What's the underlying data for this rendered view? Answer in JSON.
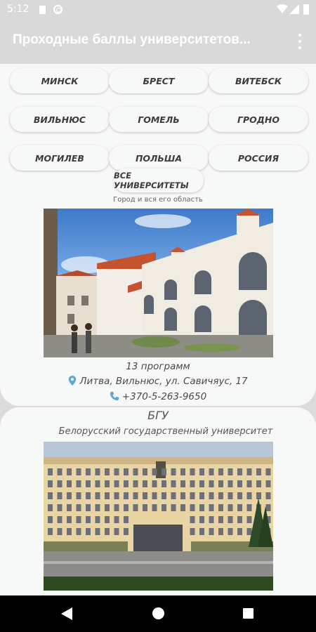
{
  "status_bar": {
    "time": "5:12"
  },
  "app_bar": {
    "title": "Проходные баллы университетов..."
  },
  "filters": {
    "cities": [
      "МИНСК",
      "БРЕСТ",
      "ВИТЕБСК",
      "ВИЛЬНЮС",
      "ГОМЕЛЬ",
      "ГРОДНО",
      "МОГИЛЕВ",
      "ПОЛЬША",
      "РОССИЯ"
    ],
    "all_label": "ВСЕ УНИВЕРСИТЕТЫ",
    "hint": "Город и вся его область"
  },
  "cards": [
    {
      "programs": "13 программ",
      "address": "Литва, Вильнюс, ул. Савичяус, 17",
      "phone": "+370-5-263-9650"
    },
    {
      "abbr": "БГУ",
      "full_name": "Белорусский государственный университет"
    }
  ],
  "colors": {
    "accent": "#5aa9d6",
    "app_bar": "#d9d9d9",
    "card_bg": "#f7f8f8"
  },
  "icons": [
    "wifi-icon",
    "signal-icon",
    "battery-icon",
    "overflow-menu-icon",
    "location-pin-icon",
    "phone-icon",
    "back-icon",
    "home-icon",
    "recents-icon"
  ]
}
